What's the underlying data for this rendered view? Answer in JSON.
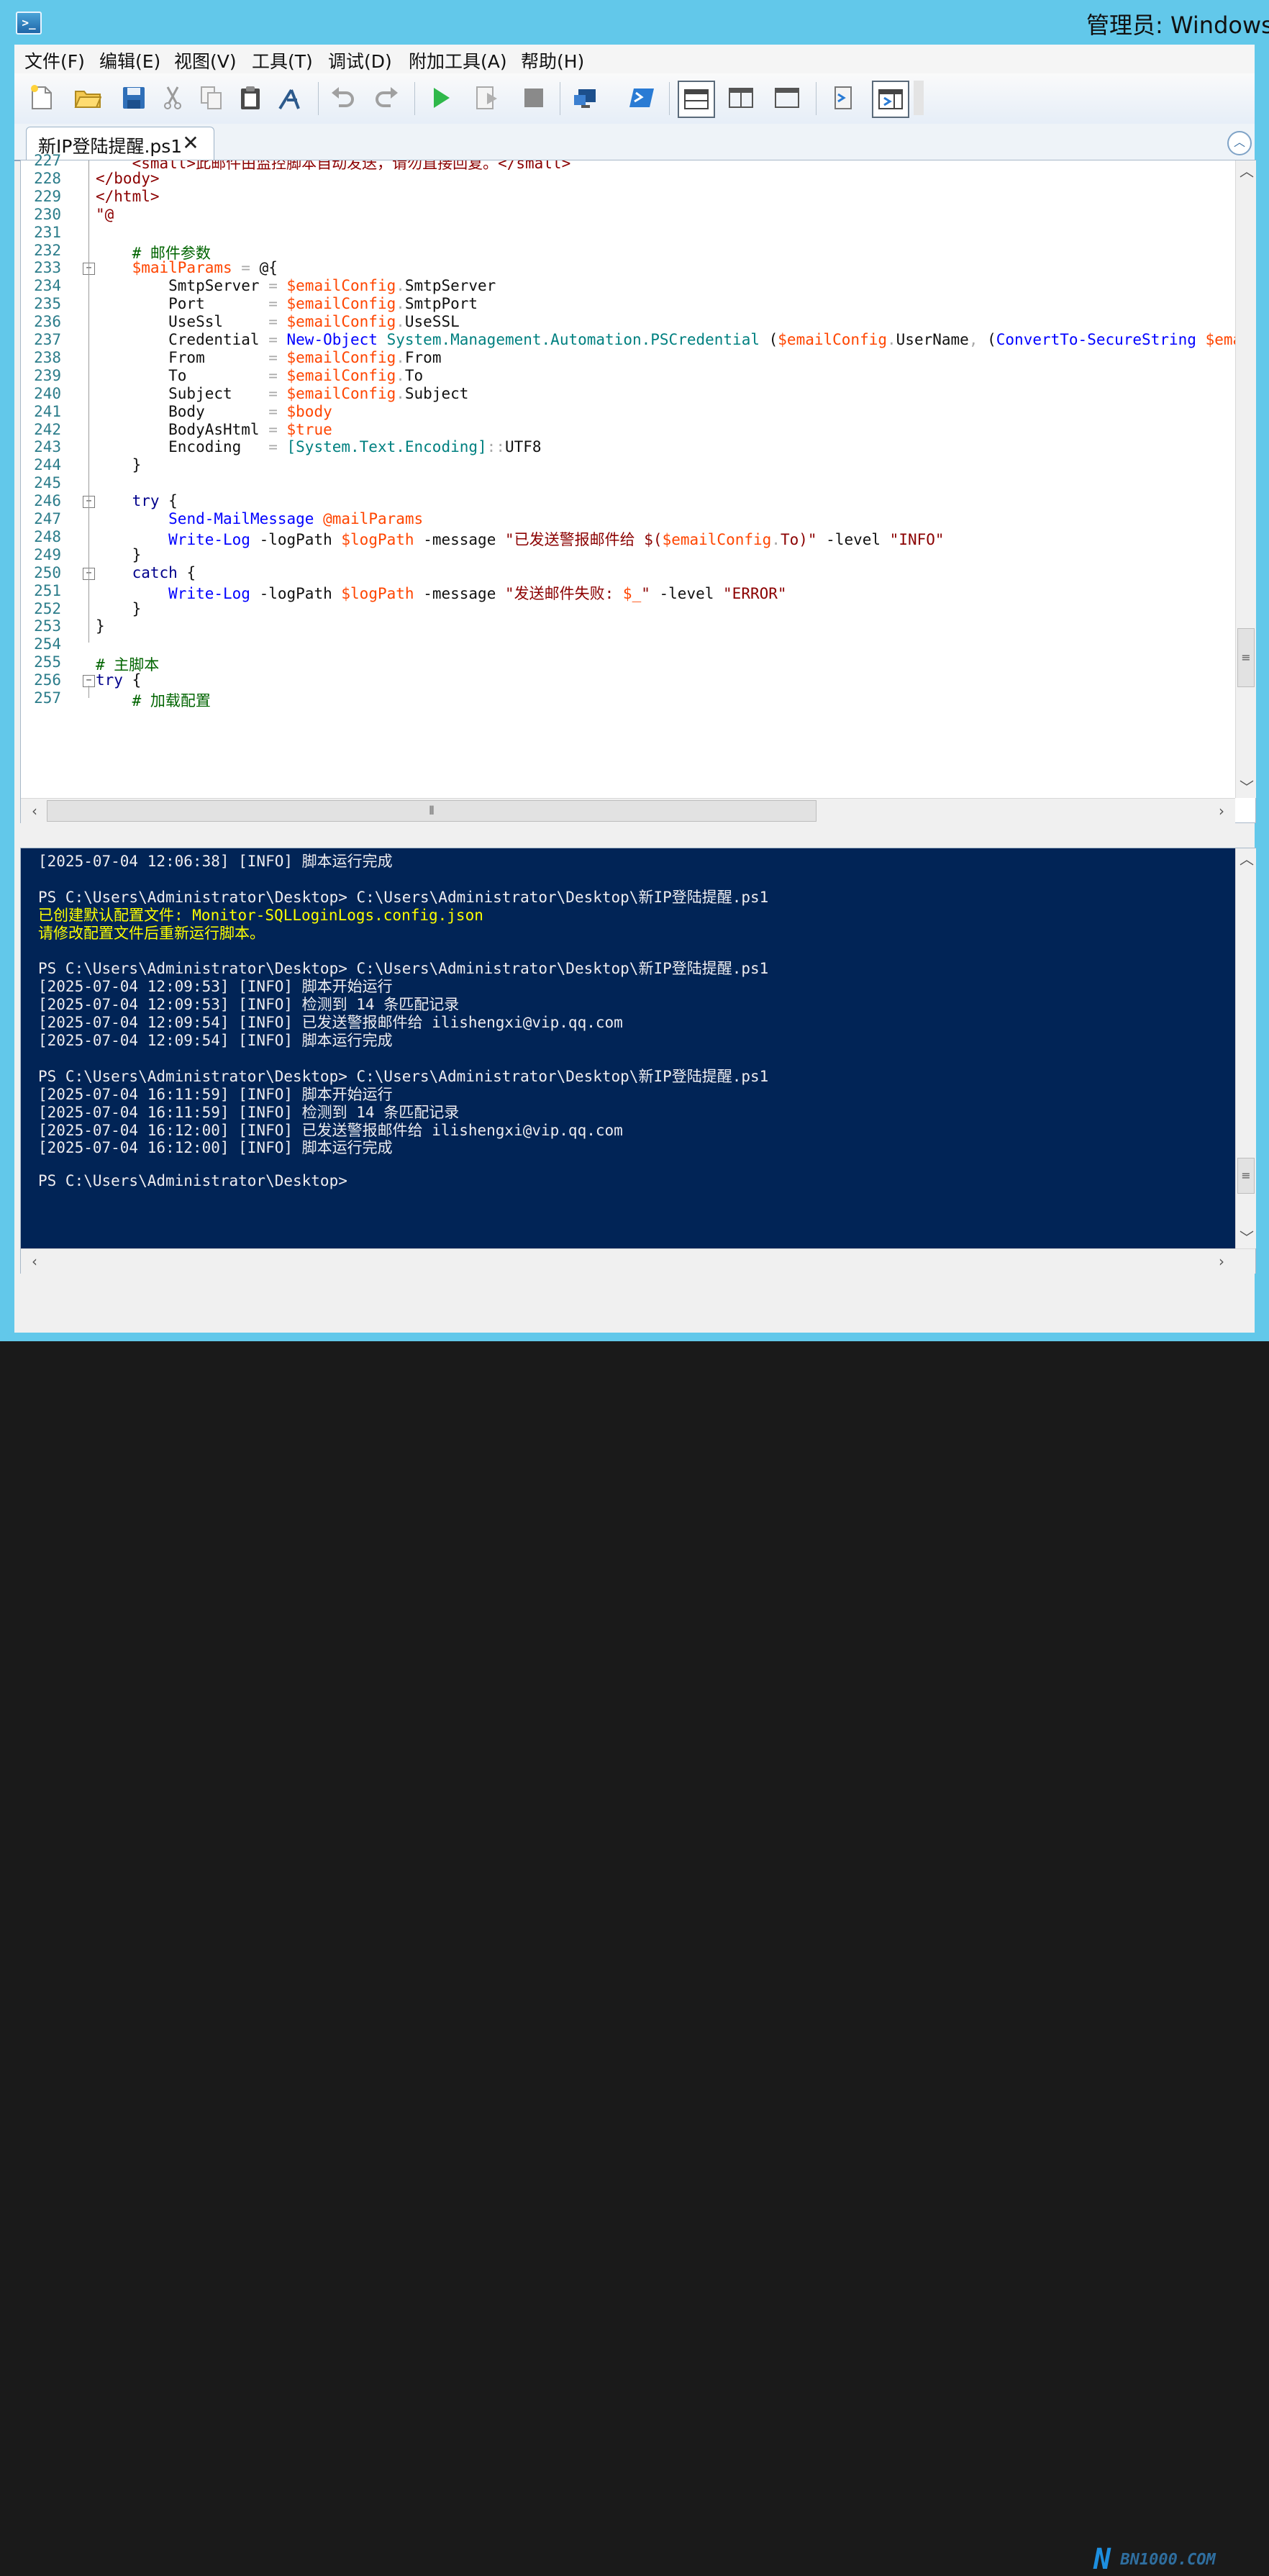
{
  "window": {
    "title": "管理员: Windows P"
  },
  "menu": [
    {
      "label": "文件(F)"
    },
    {
      "label": "编辑(E)"
    },
    {
      "label": "视图(V)"
    },
    {
      "label": "工具(T)"
    },
    {
      "label": "调试(D)"
    },
    {
      "label": "附加工具(A)"
    },
    {
      "label": "帮助(H)"
    }
  ],
  "toolbar": {
    "icons": [
      "new-file-icon",
      "open-icon",
      "save-icon",
      "cut-icon",
      "copy-icon",
      "paste-icon",
      "clear-console-icon",
      "undo-icon",
      "redo-icon",
      "run-icon",
      "run-selection-icon",
      "stop-icon",
      "remote-powershell-icon",
      "powershell-console-icon",
      "layout-top-icon",
      "layout-right-icon",
      "layout-max-icon",
      "show-commands-icon",
      "addon-pane-icon"
    ]
  },
  "tab": {
    "label": "新IP登陆提醒.ps1",
    "close_glyph": "✕"
  },
  "editor": {
    "line_numbers": [
      "227",
      "228",
      "229",
      "230",
      "231",
      "232",
      "233",
      "234",
      "235",
      "236",
      "237",
      "238",
      "239",
      "240",
      "241",
      "242",
      "243",
      "244",
      "245",
      "246",
      "247",
      "248",
      "249",
      "250",
      "251",
      "252",
      "253",
      "254",
      "255",
      "256",
      "257"
    ],
    "lines": [
      [
        {
          "t": "    ",
          "c": ""
        },
        {
          "t": "<small>此邮件由监控脚本自动发送，请勿直接回复。</small>",
          "c": "t-tag"
        }
      ],
      [
        {
          "t": "</body>",
          "c": "t-tag"
        }
      ],
      [
        {
          "t": "</html>",
          "c": "t-tag"
        }
      ],
      [
        {
          "t": "\"@",
          "c": "t-str"
        }
      ],
      [],
      [
        {
          "t": "    ",
          "c": ""
        },
        {
          "t": "# 邮件参数",
          "c": "t-cm"
        }
      ],
      [
        {
          "t": "    ",
          "c": ""
        },
        {
          "t": "$mailParams",
          "c": "t-var"
        },
        {
          "t": " = ",
          "c": "t-op"
        },
        {
          "t": "@{",
          "c": ""
        }
      ],
      [
        {
          "t": "        SmtpServer ",
          "c": ""
        },
        {
          "t": "= ",
          "c": "t-op"
        },
        {
          "t": "$emailConfig",
          "c": "t-var"
        },
        {
          "t": ".",
          "c": "t-op"
        },
        {
          "t": "SmtpServer",
          "c": ""
        }
      ],
      [
        {
          "t": "        Port       ",
          "c": ""
        },
        {
          "t": "= ",
          "c": "t-op"
        },
        {
          "t": "$emailConfig",
          "c": "t-var"
        },
        {
          "t": ".",
          "c": "t-op"
        },
        {
          "t": "SmtpPort",
          "c": ""
        }
      ],
      [
        {
          "t": "        UseSsl     ",
          "c": ""
        },
        {
          "t": "= ",
          "c": "t-op"
        },
        {
          "t": "$emailConfig",
          "c": "t-var"
        },
        {
          "t": ".",
          "c": "t-op"
        },
        {
          "t": "UseSSL",
          "c": ""
        }
      ],
      [
        {
          "t": "        Credential ",
          "c": ""
        },
        {
          "t": "= ",
          "c": "t-op"
        },
        {
          "t": "New-Object",
          "c": "t-cmd"
        },
        {
          "t": " ",
          "c": ""
        },
        {
          "t": "System.Management.Automation.PSCredential",
          "c": "t-type"
        },
        {
          "t": " (",
          "c": ""
        },
        {
          "t": "$emailConfig",
          "c": "t-var"
        },
        {
          "t": ".",
          "c": "t-op"
        },
        {
          "t": "UserName",
          "c": ""
        },
        {
          "t": ", ",
          "c": "t-op"
        },
        {
          "t": "(",
          "c": ""
        },
        {
          "t": "ConvertTo-SecureString",
          "c": "t-cmd"
        },
        {
          "t": " ",
          "c": ""
        },
        {
          "t": "$emailConf",
          "c": "t-var"
        }
      ],
      [
        {
          "t": "        From       ",
          "c": ""
        },
        {
          "t": "= ",
          "c": "t-op"
        },
        {
          "t": "$emailConfig",
          "c": "t-var"
        },
        {
          "t": ".",
          "c": "t-op"
        },
        {
          "t": "From",
          "c": ""
        }
      ],
      [
        {
          "t": "        To         ",
          "c": ""
        },
        {
          "t": "= ",
          "c": "t-op"
        },
        {
          "t": "$emailConfig",
          "c": "t-var"
        },
        {
          "t": ".",
          "c": "t-op"
        },
        {
          "t": "To",
          "c": ""
        }
      ],
      [
        {
          "t": "        Subject    ",
          "c": ""
        },
        {
          "t": "= ",
          "c": "t-op"
        },
        {
          "t": "$emailConfig",
          "c": "t-var"
        },
        {
          "t": ".",
          "c": "t-op"
        },
        {
          "t": "Subject",
          "c": ""
        }
      ],
      [
        {
          "t": "        Body       ",
          "c": ""
        },
        {
          "t": "= ",
          "c": "t-op"
        },
        {
          "t": "$body",
          "c": "t-var"
        }
      ],
      [
        {
          "t": "        BodyAsHtml ",
          "c": ""
        },
        {
          "t": "= ",
          "c": "t-op"
        },
        {
          "t": "$true",
          "c": "t-var"
        }
      ],
      [
        {
          "t": "        Encoding   ",
          "c": ""
        },
        {
          "t": "= ",
          "c": "t-op"
        },
        {
          "t": "[System.Text.Encoding]",
          "c": "t-type"
        },
        {
          "t": "::",
          "c": "t-op"
        },
        {
          "t": "UTF8",
          "c": ""
        }
      ],
      [
        {
          "t": "    }",
          "c": ""
        }
      ],
      [],
      [
        {
          "t": "    ",
          "c": ""
        },
        {
          "t": "try",
          "c": "t-kw"
        },
        {
          "t": " {",
          "c": ""
        }
      ],
      [
        {
          "t": "        ",
          "c": ""
        },
        {
          "t": "Send-MailMessage",
          "c": "t-cmd"
        },
        {
          "t": " ",
          "c": ""
        },
        {
          "t": "@mailParams",
          "c": "t-var"
        }
      ],
      [
        {
          "t": "        ",
          "c": ""
        },
        {
          "t": "Write-Log",
          "c": "t-cmd"
        },
        {
          "t": " -logPath ",
          "c": ""
        },
        {
          "t": "$logPath",
          "c": "t-var"
        },
        {
          "t": " -message ",
          "c": ""
        },
        {
          "t": "\"已发送警报邮件给 $(",
          "c": "t-str"
        },
        {
          "t": "$emailConfig",
          "c": "t-var"
        },
        {
          "t": ".",
          "c": "t-op"
        },
        {
          "t": "To)\"",
          "c": "t-str"
        },
        {
          "t": " -level ",
          "c": ""
        },
        {
          "t": "\"INFO\"",
          "c": "t-str"
        }
      ],
      [
        {
          "t": "    }",
          "c": ""
        }
      ],
      [
        {
          "t": "    ",
          "c": ""
        },
        {
          "t": "catch",
          "c": "t-kw"
        },
        {
          "t": " {",
          "c": ""
        }
      ],
      [
        {
          "t": "        ",
          "c": ""
        },
        {
          "t": "Write-Log",
          "c": "t-cmd"
        },
        {
          "t": " -logPath ",
          "c": ""
        },
        {
          "t": "$logPath",
          "c": "t-var"
        },
        {
          "t": " -message ",
          "c": ""
        },
        {
          "t": "\"发送邮件失败: ",
          "c": "t-str"
        },
        {
          "t": "$_",
          "c": "t-var"
        },
        {
          "t": "\"",
          "c": "t-str"
        },
        {
          "t": " -level ",
          "c": ""
        },
        {
          "t": "\"ERROR\"",
          "c": "t-str"
        }
      ],
      [
        {
          "t": "    }",
          "c": ""
        }
      ],
      [
        {
          "t": "}",
          "c": ""
        }
      ],
      [],
      [
        {
          "t": "# 主脚本",
          "c": "t-cm"
        }
      ],
      [
        {
          "t": "try",
          "c": "t-kw"
        },
        {
          "t": " {",
          "c": ""
        }
      ],
      [
        {
          "t": "    ",
          "c": ""
        },
        {
          "t": "# 加载配置",
          "c": "t-cm"
        }
      ]
    ]
  },
  "console": {
    "lines": [
      {
        "text": "[2025-07-04 12:06:38] [INFO] 脚本运行完成",
        "style": ""
      },
      {
        "text": "",
        "style": ""
      },
      {
        "text": "PS C:\\Users\\Administrator\\Desktop> C:\\Users\\Administrator\\Desktop\\新IP登陆提醒.ps1",
        "style": ""
      },
      {
        "text": "已创建默认配置文件: Monitor-SQLLoginLogs.config.json",
        "style": "yellow"
      },
      {
        "text": "请修改配置文件后重新运行脚本。",
        "style": "yellow"
      },
      {
        "text": "",
        "style": ""
      },
      {
        "text": "PS C:\\Users\\Administrator\\Desktop> C:\\Users\\Administrator\\Desktop\\新IP登陆提醒.ps1",
        "style": ""
      },
      {
        "text": "[2025-07-04 12:09:53] [INFO] 脚本开始运行",
        "style": ""
      },
      {
        "text": "[2025-07-04 12:09:53] [INFO] 检测到 14 条匹配记录",
        "style": ""
      },
      {
        "text": "[2025-07-04 12:09:54] [INFO] 已发送警报邮件给 ilishengxi@vip.qq.com",
        "style": ""
      },
      {
        "text": "[2025-07-04 12:09:54] [INFO] 脚本运行完成",
        "style": ""
      },
      {
        "text": "",
        "style": ""
      },
      {
        "text": "PS C:\\Users\\Administrator\\Desktop> C:\\Users\\Administrator\\Desktop\\新IP登陆提醒.ps1",
        "style": ""
      },
      {
        "text": "[2025-07-04 16:11:59] [INFO] 脚本开始运行",
        "style": ""
      },
      {
        "text": "[2025-07-04 16:11:59] [INFO] 检测到 14 条匹配记录",
        "style": ""
      },
      {
        "text": "[2025-07-04 16:12:00] [INFO] 已发送警报邮件给 ilishengxi@vip.qq.com",
        "style": ""
      },
      {
        "text": "[2025-07-04 16:12:00] [INFO] 脚本运行完成",
        "style": ""
      },
      {
        "text": "",
        "style": ""
      },
      {
        "text": "PS C:\\Users\\Administrator\\Desktop>",
        "style": ""
      }
    ]
  },
  "watermark": {
    "logo_letter": "N",
    "text": "BN1000.COM"
  },
  "colors": {
    "title_bar": "#62c8ea",
    "console_bg": "#012456",
    "console_warning": "#ffff00"
  }
}
